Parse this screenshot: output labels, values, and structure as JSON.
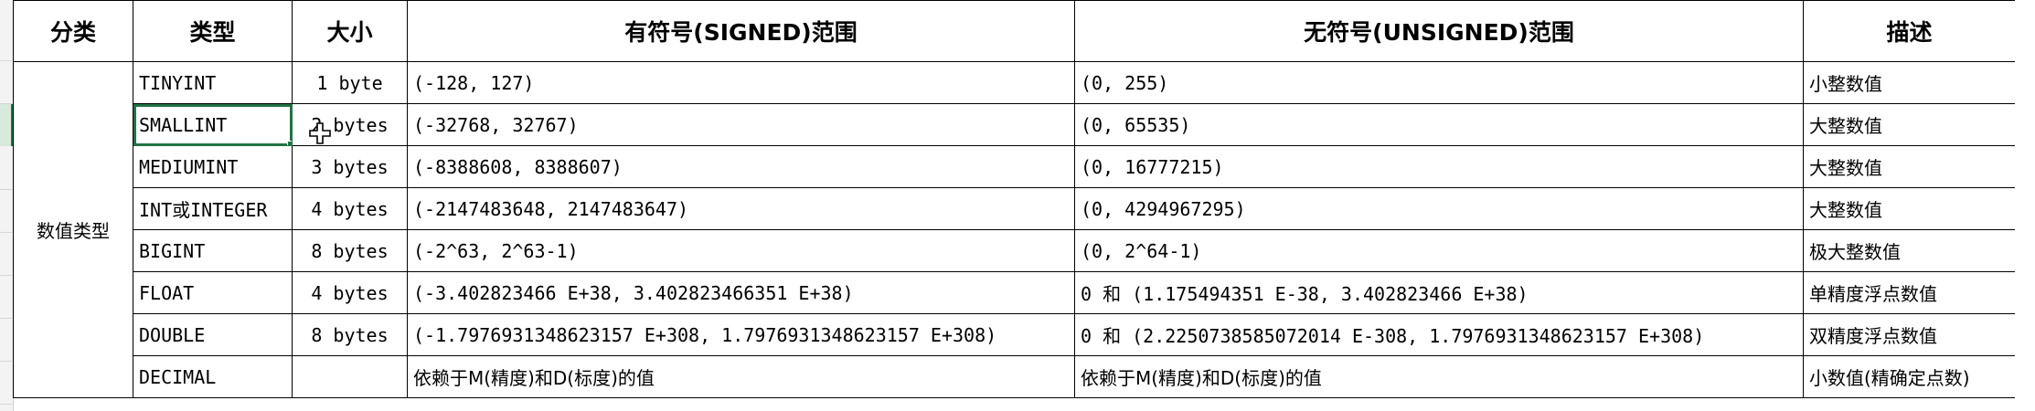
{
  "sheet": {
    "columns": [
      "分类",
      "类型",
      "大小",
      "有符号(SIGNED)范围",
      "无符号(UNSIGNED)范围",
      "描述"
    ],
    "category": "数值类型",
    "rows": [
      {
        "type": "TINYINT",
        "size": "1 byte",
        "signed": "(-128, 127)",
        "unsigned": "(0, 255)",
        "desc": "小整数值"
      },
      {
        "type": "SMALLINT",
        "size": "2 bytes",
        "signed": "(-32768, 32767)",
        "unsigned": "(0, 65535)",
        "desc": "大整数值"
      },
      {
        "type": "MEDIUMINT",
        "size": "3 bytes",
        "signed": "(-8388608, 8388607)",
        "unsigned": "(0, 16777215)",
        "desc": "大整数值"
      },
      {
        "type": "INT或INTEGER",
        "size": "4 bytes",
        "signed": "(-2147483648, 2147483647)",
        "unsigned": "(0, 4294967295)",
        "desc": "大整数值"
      },
      {
        "type": "BIGINT",
        "size": "8 bytes",
        "signed": "(-2^63, 2^63-1)",
        "unsigned": "(0, 2^64-1)",
        "desc": "极大整数值"
      },
      {
        "type": "FLOAT",
        "size": "4 bytes",
        "signed": "(-3.402823466 E+38, 3.402823466351 E+38)",
        "unsigned": "0 和 (1.175494351 E-38, 3.402823466 E+38)",
        "desc": "单精度浮点数值"
      },
      {
        "type": "DOUBLE",
        "size": "8 bytes",
        "signed": "(-1.7976931348623157 E+308, 1.7976931348623157 E+308)",
        "unsigned": "0 和 (2.2250738585072014 E-308, 1.7976931348623157 E+308)",
        "desc": "双精度浮点数值"
      },
      {
        "type": "DECIMAL",
        "size": "",
        "signed": "依赖于M(精度)和D(标度)的值",
        "unsigned": "依赖于M(精度)和D(标度)的值",
        "desc": "小数值(精确定点数)"
      }
    ],
    "selected_cell": "SMALLINT",
    "accent_color": "#217346"
  },
  "icons": {
    "cursor": "cell-select-cursor-icon"
  }
}
